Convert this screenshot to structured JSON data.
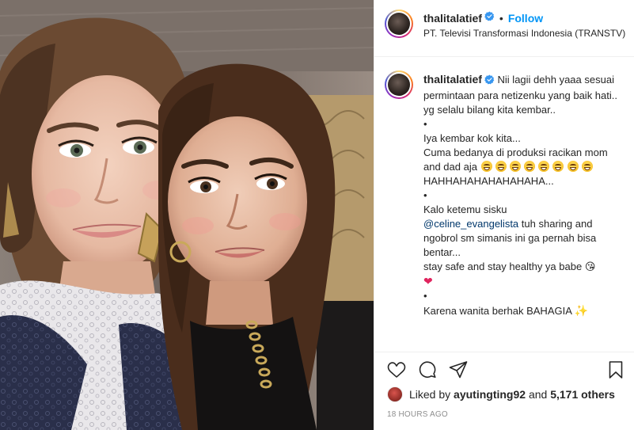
{
  "post": {
    "username": "thalitalatief",
    "separator": "•",
    "follow_label": "Follow",
    "location": "PT. Televisi Transformasi Indonesia (TRANSTV)"
  },
  "caption": {
    "username": "thalitalatief",
    "line1": "Nii lagii dehh yaaa sesuai permintaan para netizenku yang baik hati.. yg selalu bilang kita kembar..",
    "bullet1": "•",
    "line2": "Iya kembar kok kita...",
    "line3": "Cuma bedanya di produksi racikan mom and dad aja",
    "line4": "HAHHAHAHAHAHAHAHA...",
    "bullet2": "•",
    "line5a": "Kalo ketemu sisku",
    "mention": "@celine_evangelista",
    "line5b": "tuh sharing and ngobrol sm simanis ini ga pernah bisa bentar...",
    "line6": "stay safe and stay healthy ya babe",
    "bullet3": "•",
    "line7": "Karena wanita berhak BAHAGIA",
    "emoji_heart": "❤",
    "emoji_sparkle": "✨",
    "emoji_kiss": "😘"
  },
  "likes": {
    "prefix": "Liked by",
    "user": "ayutingting92",
    "and": "and",
    "count": "5,171 others"
  },
  "timestamp": "18 HOURS AGO",
  "icons": {
    "like": "heart-icon",
    "comment": "comment-icon",
    "share": "share-icon",
    "save": "bookmark-icon",
    "verified": "verified-badge-icon"
  },
  "colors": {
    "accent": "#0095f6",
    "verified": "#3897f0",
    "mention": "#00376b",
    "muted": "#8e8e8e"
  }
}
